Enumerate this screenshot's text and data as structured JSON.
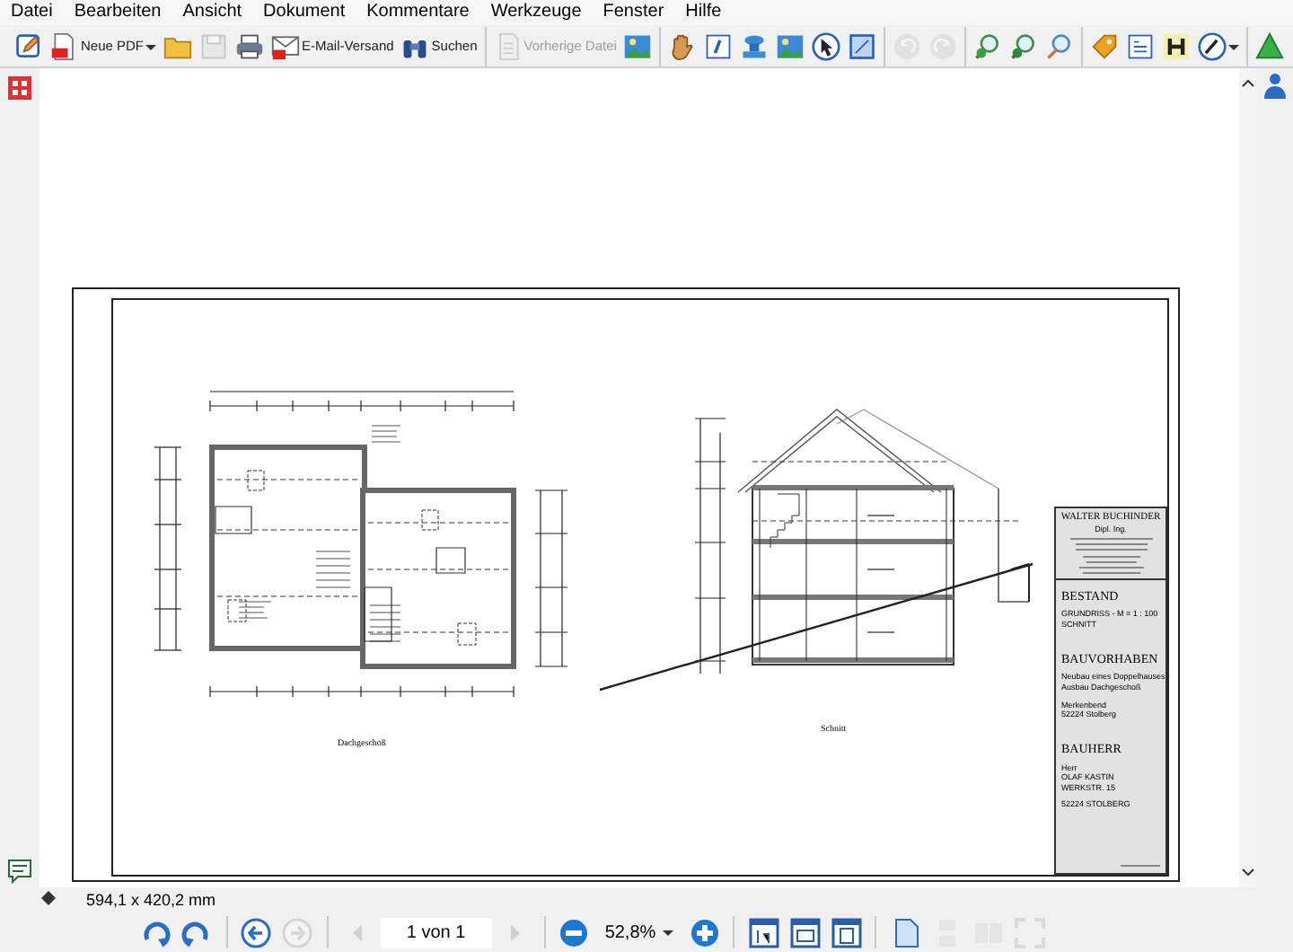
{
  "menu": [
    "Datei",
    "Bearbeiten",
    "Ansicht",
    "Dokument",
    "Kommentare",
    "Werkzeuge",
    "Fenster",
    "Hilfe"
  ],
  "toolbar": {
    "groups": [
      [
        {
          "disabled": false,
          "menu": false
        },
        {
          "label": "Neue PDF",
          "disabled": false,
          "menu": true
        },
        {
          "disabled": false,
          "menu": false
        },
        {
          "disabled": true,
          "menu": false
        },
        {
          "disabled": false,
          "menu": false
        },
        {
          "label": "E-Mail-Versand",
          "disabled": false,
          "menu": false
        },
        {
          "label": "Suchen",
          "disabled": false,
          "menu": false
        }
      ],
      [
        {
          "label": "Vorherige Datei",
          "disabled": true,
          "menu": false
        },
        {
          "disabled": false,
          "menu": false
        }
      ],
      [
        {
          "disabled": false,
          "menu": false
        },
        {
          "disabled": false,
          "menu": false
        },
        {
          "disabled": false,
          "menu": false
        },
        {
          "disabled": false,
          "menu": false
        },
        {
          "disabled": false,
          "menu": false
        },
        {
          "disabled": false,
          "menu": false
        }
      ],
      [
        {
          "disabled": true,
          "menu": false
        },
        {
          "disabled": true,
          "menu": false
        }
      ],
      [
        {
          "disabled": false,
          "menu": false
        },
        {
          "disabled": false,
          "menu": false
        },
        {
          "disabled": false,
          "menu": false
        }
      ],
      [
        {
          "disabled": false,
          "menu": false
        },
        {
          "disabled": false,
          "menu": false
        },
        {
          "disabled": false,
          "menu": false
        },
        {
          "disabled": false,
          "menu": true
        }
      ],
      [
        {
          "disabled": false,
          "menu": false
        }
      ]
    ]
  },
  "drawing": {
    "plan_label": "Dachgeschoß",
    "section_label": "Schnitt",
    "title_block": {
      "architect": [
        "WALTER BUCHINDER",
        "Dipl. Ing."
      ],
      "sections": [
        {
          "heading": "BESTAND",
          "blocks": [
            [
              "GRUNDRISS - M = 1 : 100",
              "SCHNITT"
            ]
          ]
        },
        {
          "heading": "BAUVORHABEN",
          "blocks": [
            [
              "Neubau eines Doppelhauses",
              "Ausbau Dachgeschoß"
            ],
            [
              "Merkenbend",
              "52224 Stolberg"
            ]
          ]
        },
        {
          "heading": "BAUHERR",
          "blocks": [
            [
              "Herr",
              "OLAF KASTIN",
              "WERKSTR. 15"
            ],
            [
              "52224 STOLBERG"
            ]
          ]
        }
      ]
    }
  },
  "status_bar": {
    "page_size": "594,1 x 420,2 mm"
  },
  "navigation": [
    {
      "kind": "button",
      "disabled": false
    },
    {
      "kind": "button",
      "disabled": false
    },
    {
      "kind": "separator"
    },
    {
      "kind": "button",
      "disabled": false
    },
    {
      "kind": "button",
      "disabled": true
    },
    {
      "kind": "separator"
    },
    {
      "kind": "button",
      "disabled": true
    },
    {
      "kind": "field",
      "value": "1 von 1"
    },
    {
      "kind": "button",
      "disabled": true
    },
    {
      "kind": "separator"
    },
    {
      "kind": "button",
      "disabled": false
    },
    {
      "kind": "dropdown",
      "value": "52,8%"
    },
    {
      "kind": "button",
      "disabled": false
    },
    {
      "kind": "separator"
    },
    {
      "kind": "button",
      "disabled": false
    },
    {
      "kind": "button",
      "disabled": false
    },
    {
      "kind": "button",
      "disabled": false
    },
    {
      "kind": "separator"
    },
    {
      "kind": "button",
      "disabled": false
    },
    {
      "kind": "button",
      "disabled": true
    },
    {
      "kind": "button",
      "disabled": true
    },
    {
      "kind": "button",
      "disabled": true
    }
  ]
}
